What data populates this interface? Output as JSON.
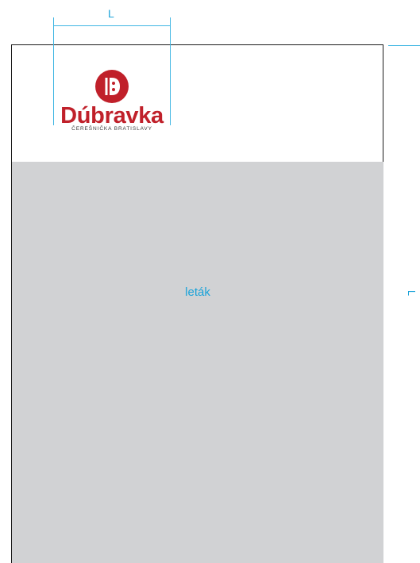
{
  "dimension": {
    "width_label": "L",
    "side_label": "L"
  },
  "logo": {
    "brand": "Dúbravka",
    "tagline": "ČEREŠNIČKA BRATISLAVY",
    "mark_letter": "D"
  },
  "flyer": {
    "label": "leták"
  },
  "colors": {
    "brand_red": "#c0202a",
    "guide_blue": "#3fb6e3",
    "grey_fill": "#d1d2d4"
  }
}
